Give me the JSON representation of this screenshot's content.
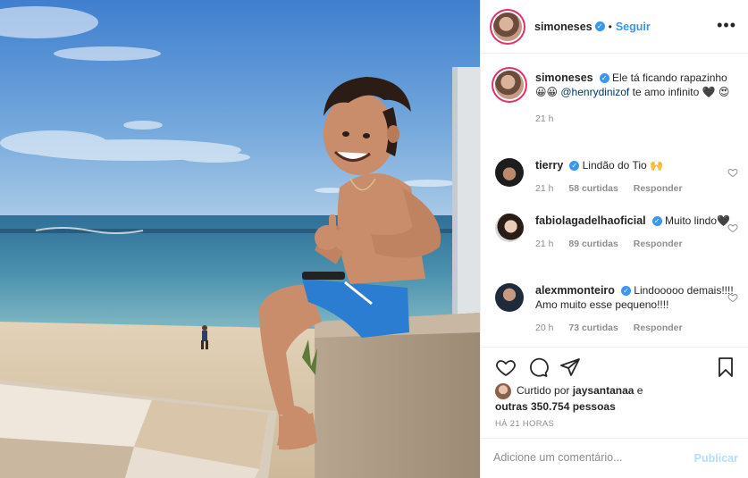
{
  "post": {
    "author": "simoneses",
    "verified": true,
    "follow_label": "Seguir",
    "more_label": "•••",
    "image_alt": "photo"
  },
  "caption": {
    "username": "simoneses",
    "text": "Ele tá ficando rapazinho 😀😀",
    "mention": "@henrydinizof",
    "text_after": "te amo infinito 🖤 😍",
    "time": "21 h"
  },
  "comments": [
    {
      "username": "tierry",
      "text": "Lindão do Tio 🙌",
      "time": "21 h",
      "likes": "58 curtidas",
      "reply": "Responder"
    },
    {
      "username": "fabiolagadelhaoficial",
      "text": "Muito lindo🖤",
      "time": "21 h",
      "likes": "89 curtidas",
      "reply": "Responder"
    },
    {
      "username": "alexmmonteiro",
      "text": "Lindooooo demais!!!! Amo muito esse pequeno!!!!",
      "time": "20 h",
      "likes": "73 curtidas",
      "reply": "Responder"
    }
  ],
  "likes": {
    "prefix": "Curtido por",
    "user": "jaysantanaa",
    "joiner": "e",
    "others": "outras 350.754 pessoas"
  },
  "timeago": "HÁ 21 HORAS",
  "comment_box": {
    "placeholder": "Adicione um comentário...",
    "publish_label": "Publicar"
  },
  "colors": {
    "accent": "#3897f0",
    "publish_disabled": "#b2dffc",
    "muted": "#8e8e8e"
  }
}
